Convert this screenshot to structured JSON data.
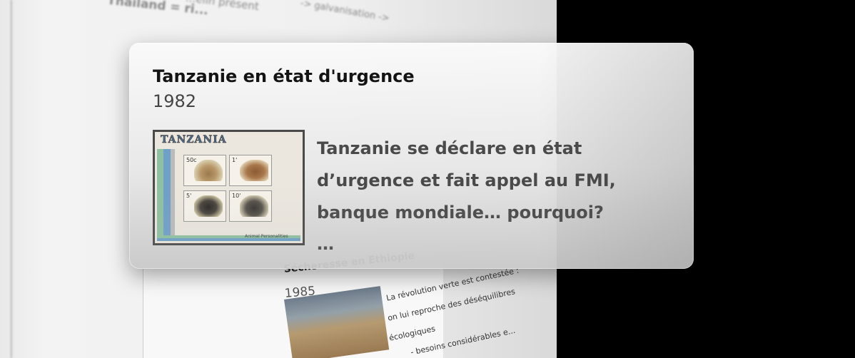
{
  "background": {
    "text_fragments": [
      "Thailand = ri...",
      "...elin présent",
      "-> galvanisation ->"
    ],
    "lower_card": {
      "title": "Sécheresse en Ethiopie",
      "year": "1985",
      "text_lines": [
        "La révolution verte est contestée :",
        "on lui reproche des déséquilibres",
        "écologiques",
        "- besoins considérables e..."
      ]
    }
  },
  "popup": {
    "title": "Tanzanie en état d'urgence",
    "year": "1982",
    "description": "Tanzanie se déclare en état d’urgence et fait appel au FMI, banque mondiale… pourquoi?",
    "ellipsis": "…",
    "stamp": {
      "country": "TANZANIA",
      "values": [
        "50c",
        "1'",
        "5'",
        "10'"
      ],
      "caption": "Animal Personalities"
    }
  },
  "colors": {
    "backdrop": "#000000",
    "popup_bg": "#ececec",
    "title_text": "#141414",
    "body_text": "#4a4a4a"
  }
}
